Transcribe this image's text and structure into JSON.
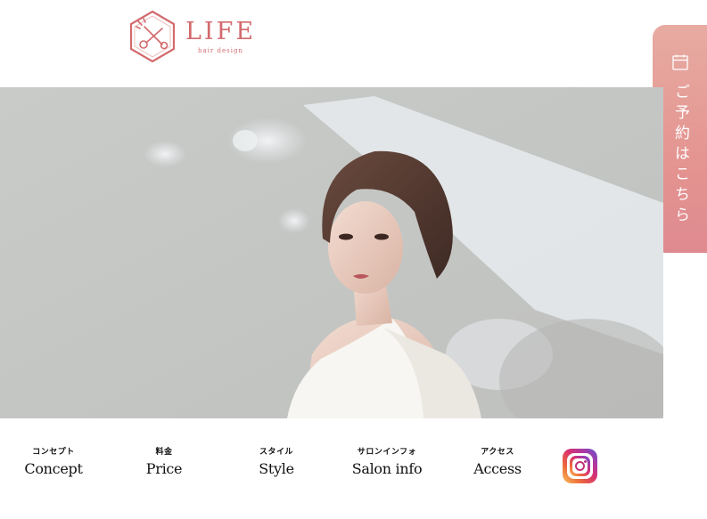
{
  "brand": {
    "name": "LIFE",
    "tagline": "hair design",
    "color": "#d36a6d"
  },
  "reservation": {
    "label": "ご予約はこちら",
    "icon": "calendar-icon",
    "color": "#e49491"
  },
  "hero": {
    "image": "woman-portrait-photo"
  },
  "nav": {
    "items": [
      {
        "jp": "コンセプト",
        "en": "Concept"
      },
      {
        "jp": "料金",
        "en": "Price"
      },
      {
        "jp": "スタイル",
        "en": "Style"
      },
      {
        "jp": "サロンインフォ",
        "en": "Salon info"
      },
      {
        "jp": "アクセス",
        "en": "Access"
      }
    ],
    "social_icon": "instagram-icon"
  }
}
